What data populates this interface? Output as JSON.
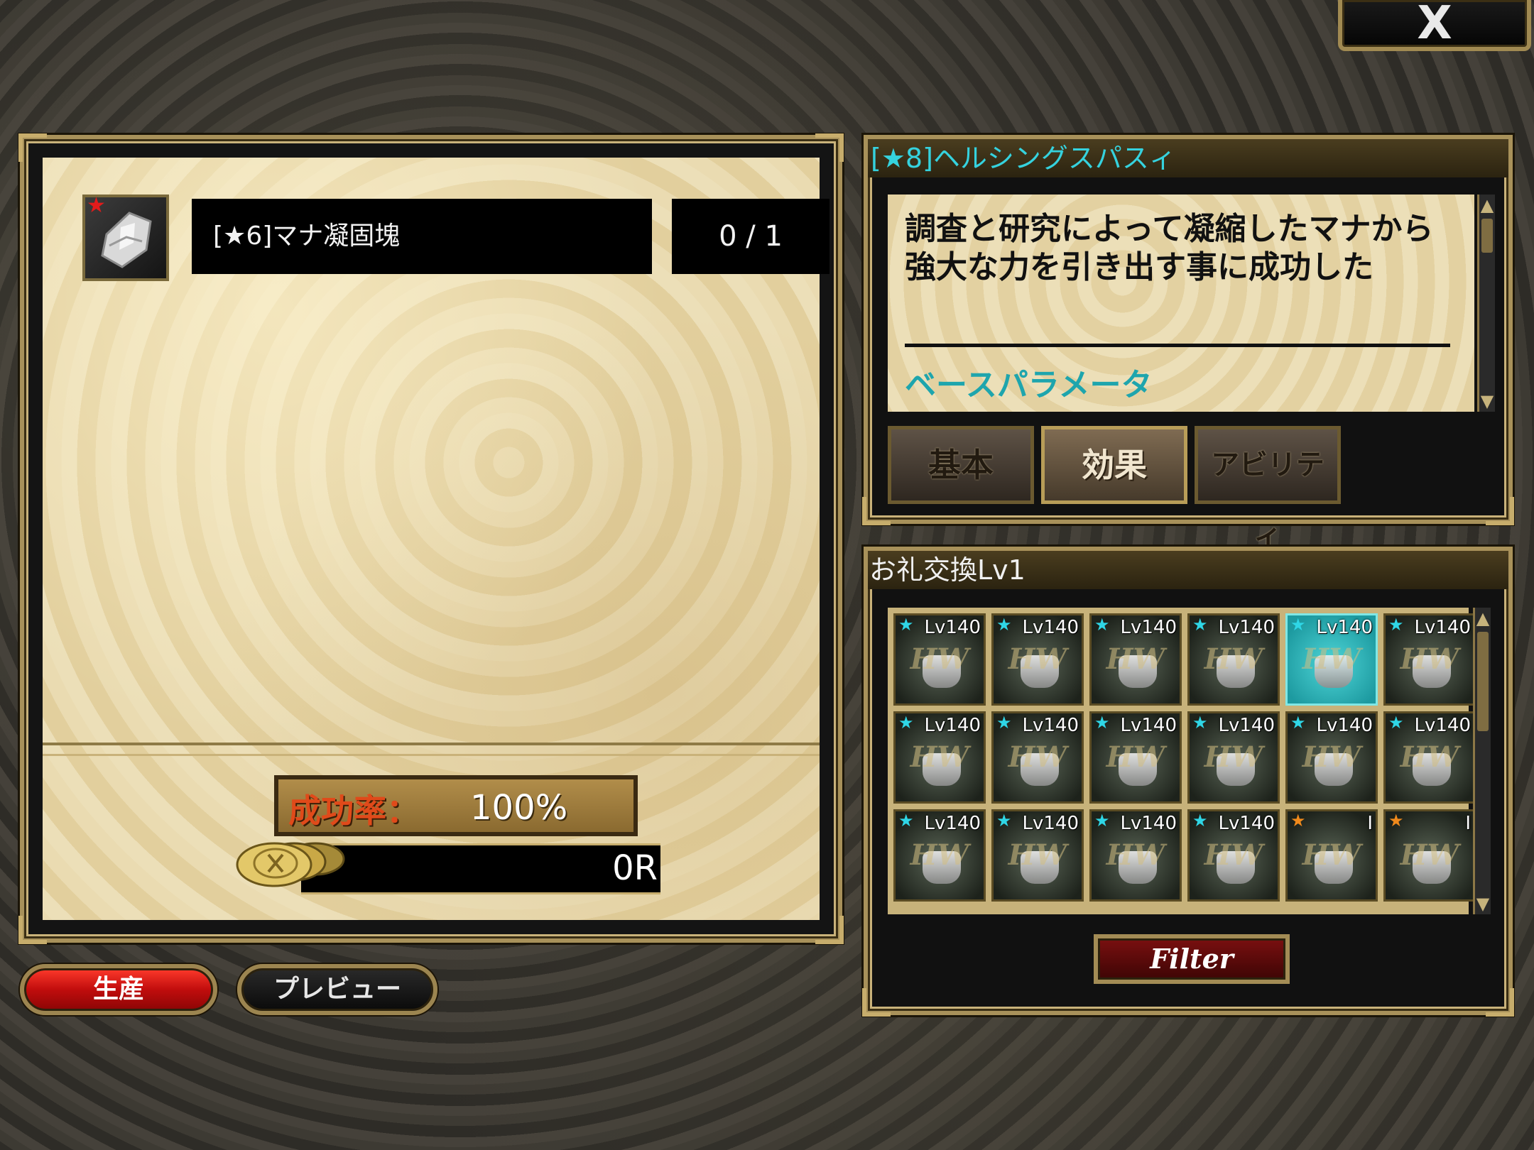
{
  "close_button": {
    "label": "X",
    "icon": "close-icon"
  },
  "crafting": {
    "material": {
      "name": "[★6]マナ凝固塊",
      "count": "0 / 1",
      "icon": "mana-crystal-icon",
      "rarity_star": "★"
    },
    "success_rate": {
      "label": "成功率：",
      "value": "100%"
    },
    "cost": {
      "value": "0R",
      "icon": "coin-icon"
    },
    "buttons": {
      "produce": "生産",
      "preview": "プレビュー"
    }
  },
  "detail": {
    "title": "[★8]ヘルシングスパスィ",
    "description": "調査と研究によって凝縮したマナから強大な力を引き出す事に成功した",
    "section_heading": "ベースパラメータ",
    "tabs": [
      {
        "label": "基本",
        "active": false
      },
      {
        "label": "効果",
        "active": true
      },
      {
        "label": "アビリティ",
        "active": false
      }
    ]
  },
  "recipes": {
    "title": "お礼交換Lv1",
    "watermark": "HW",
    "items": [
      {
        "level": "Lv140",
        "star": "★",
        "star_color": "#2fd6e6",
        "selected": false
      },
      {
        "level": "Lv140",
        "star": "★",
        "star_color": "#2fd6e6",
        "selected": false
      },
      {
        "level": "Lv140",
        "star": "★",
        "star_color": "#2fd6e6",
        "selected": false
      },
      {
        "level": "Lv140",
        "star": "★",
        "star_color": "#2fd6e6",
        "selected": false
      },
      {
        "level": "Lv140",
        "star": "★",
        "star_color": "#2fd6e6",
        "selected": true
      },
      {
        "level": "Lv140",
        "star": "★",
        "star_color": "#2fd6e6",
        "selected": false
      },
      {
        "level": "Lv140",
        "star": "★",
        "star_color": "#2fd6e6",
        "selected": false
      },
      {
        "level": "Lv140",
        "star": "★",
        "star_color": "#2fd6e6",
        "selected": false
      },
      {
        "level": "Lv140",
        "star": "★",
        "star_color": "#2fd6e6",
        "selected": false
      },
      {
        "level": "Lv140",
        "star": "★",
        "star_color": "#2fd6e6",
        "selected": false
      },
      {
        "level": "Lv140",
        "star": "★",
        "star_color": "#2fd6e6",
        "selected": false
      },
      {
        "level": "Lv140",
        "star": "★",
        "star_color": "#2fd6e6",
        "selected": false
      },
      {
        "level": "Lv140",
        "star": "★",
        "star_color": "#2fd6e6",
        "selected": false
      },
      {
        "level": "Lv140",
        "star": "★",
        "star_color": "#2fd6e6",
        "selected": false
      },
      {
        "level": "Lv140",
        "star": "★",
        "star_color": "#2fd6e6",
        "selected": false
      },
      {
        "level": "Lv140",
        "star": "★",
        "star_color": "#2fd6e6",
        "selected": false
      },
      {
        "level": "I",
        "star": "★",
        "star_color": "#f08a1c",
        "selected": false
      },
      {
        "level": "I",
        "star": "★",
        "star_color": "#f08a1c",
        "selected": false
      }
    ],
    "filter_label": "Filter"
  },
  "colors": {
    "accent_cyan": "#35d2de",
    "gold_frame": "#a8915a",
    "produce_red": "#d81414",
    "success_orange": "#e04a1a"
  }
}
